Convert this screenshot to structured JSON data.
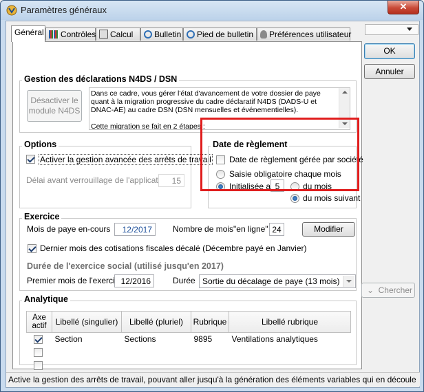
{
  "window": {
    "title": "Paramètres généraux",
    "close_label": "✕"
  },
  "tabs": [
    {
      "label": "Général"
    },
    {
      "label": "Contrôles"
    },
    {
      "label": "Calcul"
    },
    {
      "label": "Bulletin"
    },
    {
      "label": "Pied de bulletin"
    },
    {
      "label": "Préférences utilisateur"
    }
  ],
  "n4ds": {
    "title": "Gestion des déclarations N4DS / DSN",
    "button_label": "Désactiver le module N4DS",
    "text": "Dans ce cadre, vous gérer l'état d'avancement de votre dossier de paye quant à la migration progressive du cadre déclaratif N4DS (DADS-U et DNAC-AE) au cadre DSN (DSN mensuelles et événementielles).\n\nCette migration se fait en 2 étapes :"
  },
  "options": {
    "title": "Options",
    "checkbox_label": "Activer la gestion avancée des arrêts de travail",
    "delay_label": "Délai avant verrouillage de l'application",
    "delay_value": "15"
  },
  "reglement": {
    "title": "Date de règlement",
    "societe_label": "Date de règlement gérée par société",
    "saisie_label": "Saisie obligatoire chaque mois",
    "init_label": "Initialisée au",
    "init_value": "5",
    "mois_label": "du mois",
    "suivant_label": "du mois suivant"
  },
  "exercice": {
    "title": "Exercice",
    "mois_paye_label": "Mois de paye en-cours",
    "mois_paye_value": "12/2017",
    "nb_mois_label": "Nombre de mois\"en ligne\"",
    "nb_mois_value": "24",
    "modifier_label": "Modifier",
    "dernier_mois_label": "Dernier mois des cotisations fiscales décalé (Décembre payé en Janvier)",
    "duree_title": "Durée de l'exercice social (utilisé jusqu'en 2017)",
    "premier_mois_label": "Premier mois de l'exercice",
    "premier_mois_value": "12/2016",
    "duree_label": "Durée",
    "duree_value": "Sortie du décalage de paye (13 mois)"
  },
  "analytique": {
    "title": "Analytique",
    "headers": [
      "Axe actif",
      "Libellé (singulier)",
      "Libellé (pluriel)",
      "Rubrique",
      "Libellé rubrique"
    ],
    "rows": [
      {
        "actif": true,
        "singulier": "Section",
        "pluriel": "Sections",
        "rubrique": "9895",
        "libelle": "Ventilations analytiques"
      },
      {
        "actif": false,
        "singulier": "",
        "pluriel": "",
        "rubrique": "",
        "libelle": ""
      },
      {
        "actif": false,
        "singulier": "",
        "pluriel": "",
        "rubrique": "",
        "libelle": ""
      }
    ]
  },
  "buttons": {
    "ok": "OK",
    "annuler": "Annuler",
    "chercher": "Chercher"
  },
  "status": "Active la gestion des arrêts de travail, pouvant aller jusqu'à la génération des éléments variables qui en découle",
  "colors": {
    "highlight": "#e01d1d",
    "link_value": "#1d4f9a"
  }
}
